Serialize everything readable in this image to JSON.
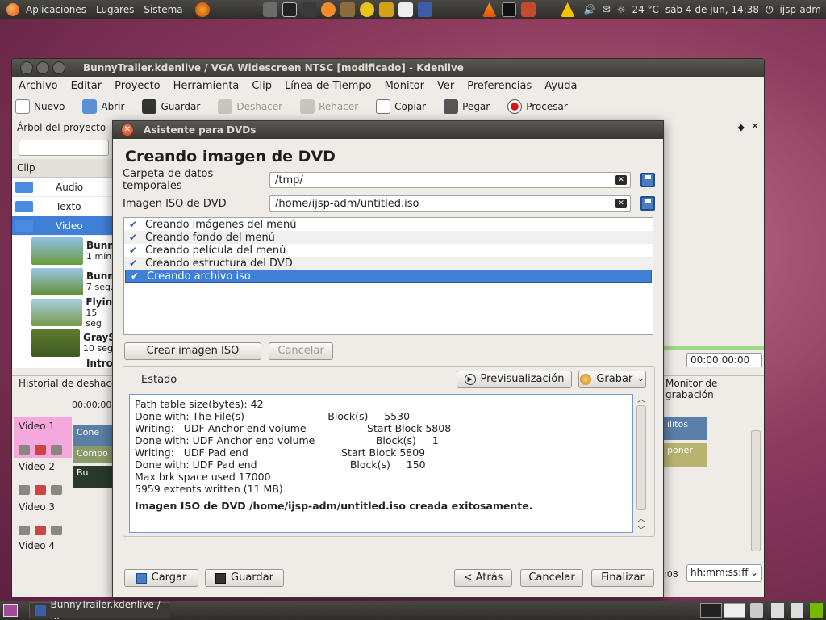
{
  "top_panel": {
    "menus": [
      "Aplicaciones",
      "Lugares",
      "Sistema"
    ],
    "weather": "24 °C",
    "clock": "sáb 4 de jun, 14:38",
    "user": "ijsp-adm"
  },
  "bottom_panel": {
    "task": "BunnyTrailer.kdenlive / ..."
  },
  "main_window": {
    "title": "BunnyTrailer.kdenlive / VGA Widescreen NTSC [modificado] - Kdenlive",
    "menu": [
      "Archivo",
      "Editar",
      "Proyecto",
      "Herramienta",
      "Clip",
      "Línea de Tiempo",
      "Monitor",
      "Ver",
      "Preferencias",
      "Ayuda"
    ],
    "toolbar": {
      "nuevo": "Nuevo",
      "abrir": "Abrir",
      "guardar": "Guardar",
      "deshacer": "Deshacer",
      "rehacer": "Rehacer",
      "copiar": "Copiar",
      "pegar": "Pegar",
      "procesar": "Procesar"
    },
    "project_tree": {
      "title": "Árbol del proyecto",
      "clip_header": "Clip",
      "folders": [
        "Audio",
        "Texto",
        "Video"
      ],
      "clips": [
        {
          "name": "Bunn",
          "dur": "1 mín."
        },
        {
          "name": "Bunn",
          "dur": "7 seg."
        },
        {
          "name": "Flyin",
          "dur": "15 seg"
        },
        {
          "name": "GrayS",
          "dur": "10 seg"
        },
        {
          "name": "Intro",
          "dur": ""
        }
      ]
    },
    "timeline": {
      "tab_history": "Historial de deshacer",
      "tab_monitor": "Monitor de grabación",
      "ruler_time": "00:00:00",
      "timecode": "00:00:00:00",
      "time_format": "hh:mm:ss:ff",
      "position": ";08",
      "tracks": [
        "Video 1",
        "Video 2",
        "Video 3",
        "Video 4"
      ],
      "clip_labels": [
        "Cone",
        "Compo",
        "Bu",
        "ilitos",
        "poner"
      ]
    }
  },
  "dialog": {
    "title": "Asistente para DVDs",
    "heading": "Creando imagen de DVD",
    "temp_label": "Carpeta de datos temporales",
    "temp_value": "/tmp/",
    "iso_label": "Imagen ISO de DVD",
    "iso_value": "/home/ijsp-adm/untitled.iso",
    "steps": [
      "Creando imágenes del menú",
      "Creando fondo del menú",
      "Creando película del menú",
      "Creando estructura del DVD",
      "Creando archivo iso"
    ],
    "create_iso": "Crear imagen ISO",
    "cancel_create": "Cancelar",
    "estado": "Estado",
    "preview": "Previsualización",
    "burn": "Grabar",
    "log_lines": [
      "",
      "Path table size(bytes): 42",
      "Done with: The File(s)                          Block(s)     5530",
      "Writing:   UDF Anchor end volume                   Start Block 5808",
      "Done with: UDF Anchor end volume                   Block(s)     1",
      "Writing:   UDF Pad end                             Start Block 5809",
      "Done with: UDF Pad end                             Block(s)     150",
      "Max brk space used 17000",
      "5959 extents written (11 MB)"
    ],
    "log_final": "Imagen ISO de DVD /home/ijsp-adm/untitled.iso creada exitosamente.",
    "load": "Cargar",
    "save": "Guardar",
    "back": "< Atrás",
    "cancel": "Cancelar",
    "finish": "Finalizar"
  }
}
